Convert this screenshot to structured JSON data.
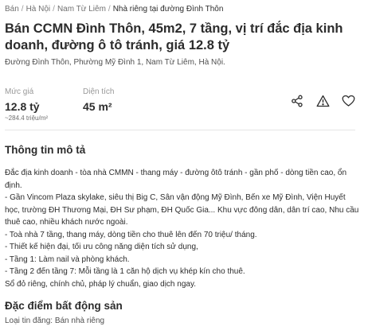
{
  "breadcrumb": [
    "Bán",
    "Hà Nội",
    "Nam Từ Liêm",
    "Nhà riêng tại đường Đình Thôn"
  ],
  "listing": {
    "title": "Bán CCMN Đình Thôn, 45m2, 7 tầng, vị trí đắc địa kinh doanh, đường ô tô tránh, giá 12.8 tỷ",
    "address": "Đường Đình Thôn, Phường Mỹ Đình 1, Nam Từ Liêm, Hà Nội."
  },
  "stats": {
    "price_label": "Mức giá",
    "price_value": "12.8 tỷ",
    "price_per_m2": "~284.4 triệu/m²",
    "area_label": "Diện tích",
    "area_value": "45 m²"
  },
  "actions": {
    "share_icon": "share-icon",
    "report_icon": "warning-icon",
    "save_icon": "heart-icon"
  },
  "description": {
    "heading": "Thông tin mô tả",
    "lines": [
      "Đắc địa kinh doanh - tòa nhà CMMN - thang máy - đường ôtô tránh - gần phố - dòng tiền cao, ổn định.",
      "- Gần Vincom Plaza skylake, siêu thị Big C, Sân vận động Mỹ Đình, Bến xe Mỹ Đình, Viện Huyết học, trường ĐH Thương Mại, ĐH Sư phạm, ĐH Quốc Gia... Khu vực đông dân, dân trí cao, Nhu cầu thuê cao, nhiều khách nước ngoài.",
      "- Toà nhà 7 tầng, thang máy, dòng tiền cho thuê lên đến 70 triệu/ tháng.",
      "- Thiết kế hiện đại, tối ưu công năng diện tích sử dụng,",
      "- Tầng 1: Làm nail và phòng khách.",
      "- Tầng 2 đến tầng 7: Mỗi tầng là 1 căn hộ dịch vụ khép kín cho thuê.",
      "Sổ đỏ riêng, chính chủ, pháp lý chuẩn, giao dịch ngay."
    ]
  },
  "features": {
    "heading": "Đặc điểm bất động sản",
    "type_line": "Loại tin đăng: Bán nhà riêng"
  }
}
